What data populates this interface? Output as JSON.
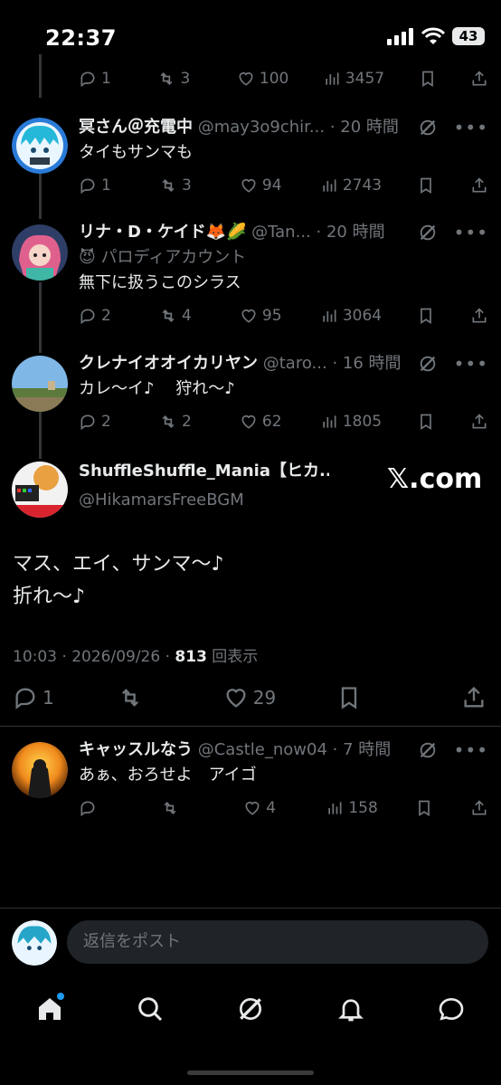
{
  "status_bar": {
    "time": "22:37",
    "battery": "43"
  },
  "tweets": [
    {
      "replies": "1",
      "retweets": "3",
      "likes": "100",
      "views": "3457"
    },
    {
      "name": "冥さん＠充電中",
      "handle": "@may3o9chir...",
      "time": "· 20 時間",
      "text": "タイもサンマも",
      "replies": "1",
      "retweets": "3",
      "likes": "94",
      "views": "2743"
    },
    {
      "name": "リナ・D・ケイド🦊🌽",
      "handle": "@Tan...",
      "time": "· 20 時間",
      "badge": "パロディアカウント",
      "text": "無下に扱うこのシラス",
      "replies": "2",
      "retweets": "4",
      "likes": "95",
      "views": "3064"
    },
    {
      "name": "クレナイオオイカリヤン",
      "handle": "@taro...",
      "time": "· 16 時間",
      "text": "カレ〜イ♪　 狩れ〜♪",
      "replies": "2",
      "retweets": "2",
      "likes": "62",
      "views": "1805"
    }
  ],
  "main_tweet": {
    "name": "ShuffleShuffle_Mania【ヒカ...",
    "handle": "@HikamarsFreeBGM",
    "watermark": "𝕏.com",
    "text": "マス、エイ、サンマ〜♪\n折れ〜♪",
    "timestamp": "10:03 · 2026/09/26 · ",
    "views_count": "813",
    "views_label": " 回表示",
    "replies": "1",
    "likes": "29"
  },
  "reply": {
    "name": "キャッスルなう",
    "handle": "@Castle_now04",
    "time": "· 7 時間",
    "text": "あぁ、おろせよ　アイゴ",
    "likes": "4",
    "views": "158"
  },
  "composer": {
    "placeholder": "返信をポスト"
  },
  "colors": {
    "background": "#000000",
    "text": "#e7e9ea",
    "secondary": "#71767b",
    "accent": "#1d9bf0"
  }
}
